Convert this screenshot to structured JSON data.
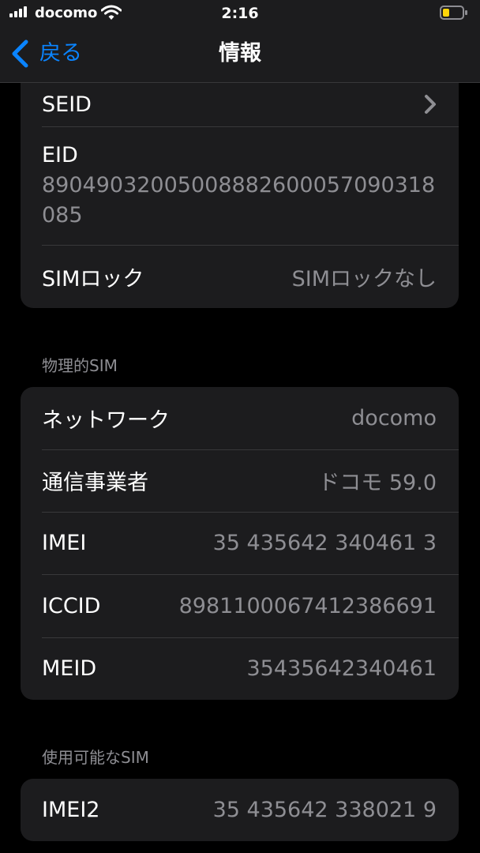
{
  "status_bar": {
    "carrier": "docomo",
    "time": "2:16",
    "battery_color": "#ffd60a"
  },
  "nav": {
    "back_label": "戻る",
    "title": "情報",
    "accent_color": "#0a84ff"
  },
  "card_top": {
    "seid_label": "SEID",
    "eid_label": "EID",
    "eid_value": "89049032005008882600057090318085",
    "sim_lock_label": "SIMロック",
    "sim_lock_value": "SIMロックなし"
  },
  "physical_sim": {
    "header": "物理的SIM",
    "rows": [
      {
        "label": "ネットワーク",
        "value": "docomo"
      },
      {
        "label": "通信事業者",
        "value": "ドコモ 59.0"
      },
      {
        "label": "IMEI",
        "value": "35 435642 340461 3"
      },
      {
        "label": "ICCID",
        "value": "8981100067412386691"
      },
      {
        "label": "MEID",
        "value": "35435642340461"
      }
    ]
  },
  "available_sim": {
    "header": "使用可能なSIM",
    "rows": [
      {
        "label": "IMEI2",
        "value": "35 435642 338021 9"
      }
    ]
  },
  "icons": {
    "signal": "cellular-signal-icon",
    "wifi": "wifi-icon",
    "battery": "battery-icon",
    "back": "chevron-left-icon",
    "disclosure": "chevron-right-icon"
  }
}
